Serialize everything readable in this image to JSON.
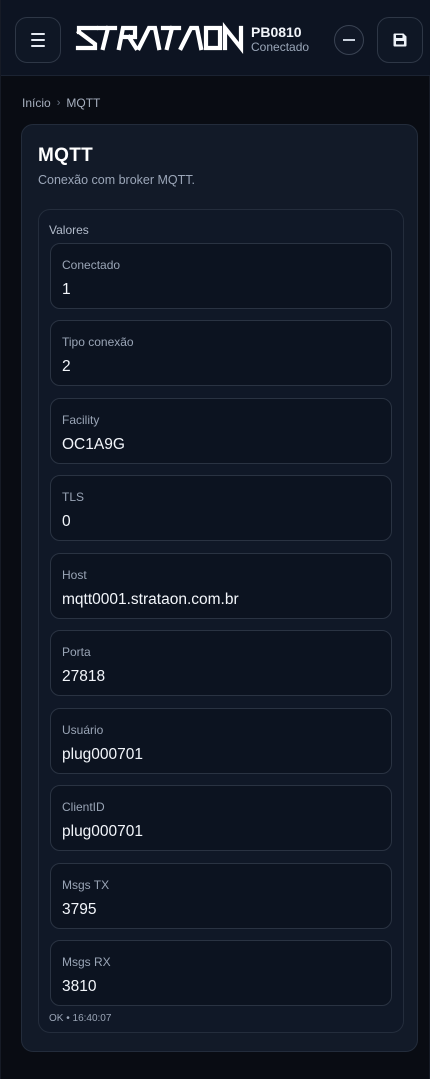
{
  "header": {
    "brand": "STRATAON",
    "device_id": "PB0810",
    "device_status": "Conectado",
    "icons": {
      "menu": "menu-icon",
      "minimize": "minus-circle-icon",
      "save": "save-icon"
    }
  },
  "breadcrumb": {
    "home": "Início",
    "separator": "›",
    "current": "MQTT"
  },
  "card": {
    "title": "MQTT",
    "subtitle": "Conexão com broker MQTT.",
    "group_label": "Valores",
    "fields": [
      {
        "label": "Conectado",
        "value": "1"
      },
      {
        "label": "Tipo conexão",
        "value": "2"
      },
      {
        "label": "Facility",
        "value": "OC1A9G"
      },
      {
        "label": "TLS",
        "value": "0"
      },
      {
        "label": "Host",
        "value": "mqtt0001.strataon.com.br"
      },
      {
        "label": "Porta",
        "value": "27818"
      },
      {
        "label": "Usuário",
        "value": "plug000701"
      },
      {
        "label": "ClientID",
        "value": "plug000701"
      },
      {
        "label": "Msgs TX",
        "value": "3795"
      },
      {
        "label": "Msgs RX",
        "value": "3810"
      }
    ],
    "status": "OK • 16:40:07"
  }
}
